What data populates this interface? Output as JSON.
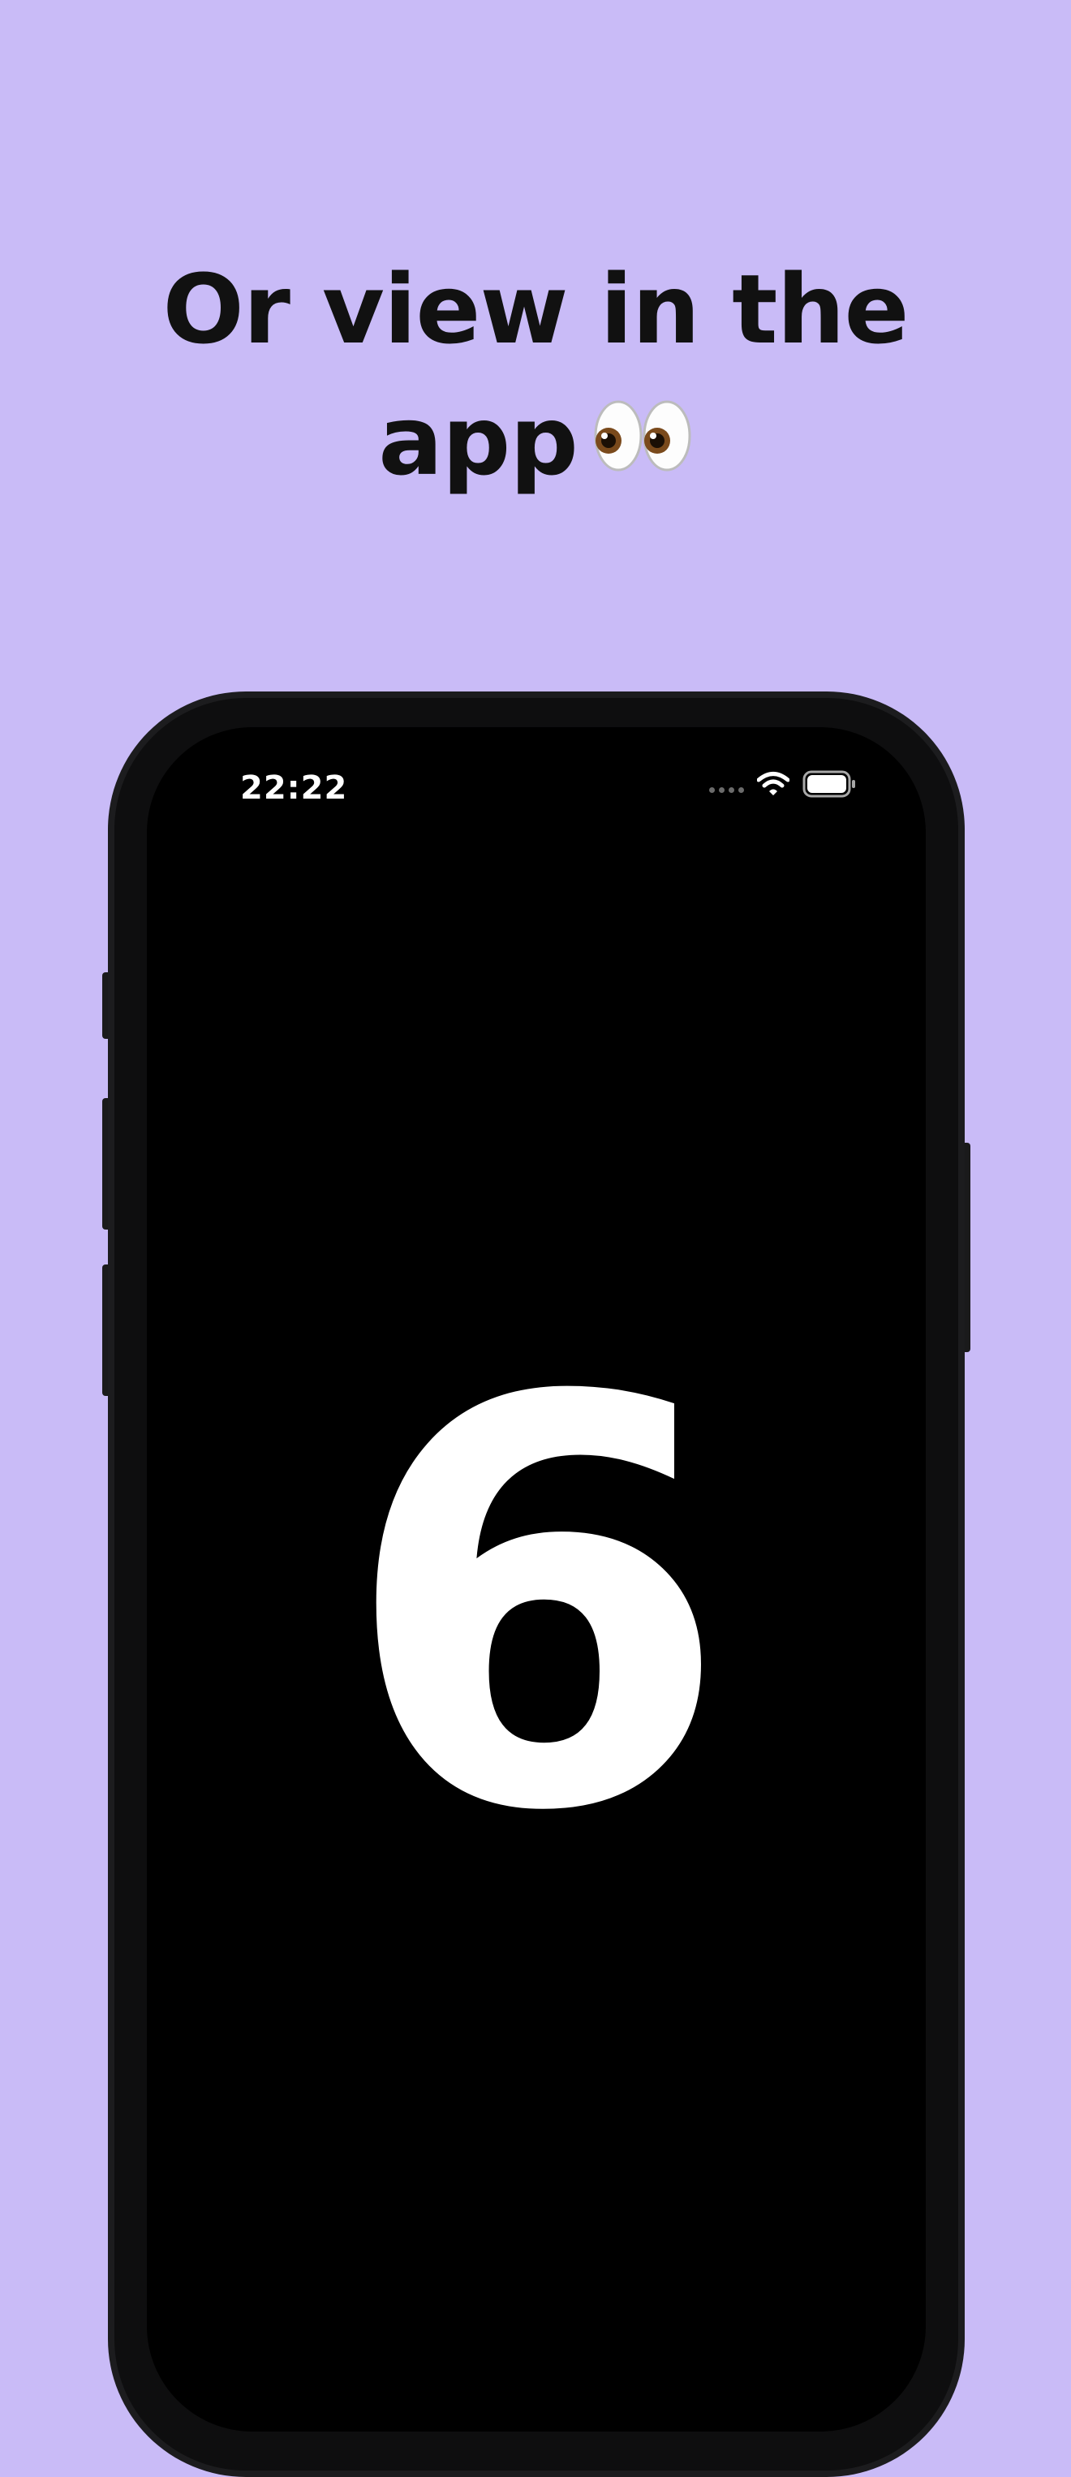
{
  "headline": {
    "line1": "Or view in the",
    "line2": "app",
    "emoji": "eyes-icon"
  },
  "status_bar": {
    "time": "22:22",
    "icons": [
      "signal-dots-icon",
      "wifi-icon",
      "battery-icon"
    ]
  },
  "screen": {
    "number": "6"
  },
  "colors": {
    "background": "#c9bbf7",
    "headline_text": "#111111",
    "phone_frame": "#1c1c1e",
    "screen": "#000000",
    "number": "#ffffff"
  }
}
